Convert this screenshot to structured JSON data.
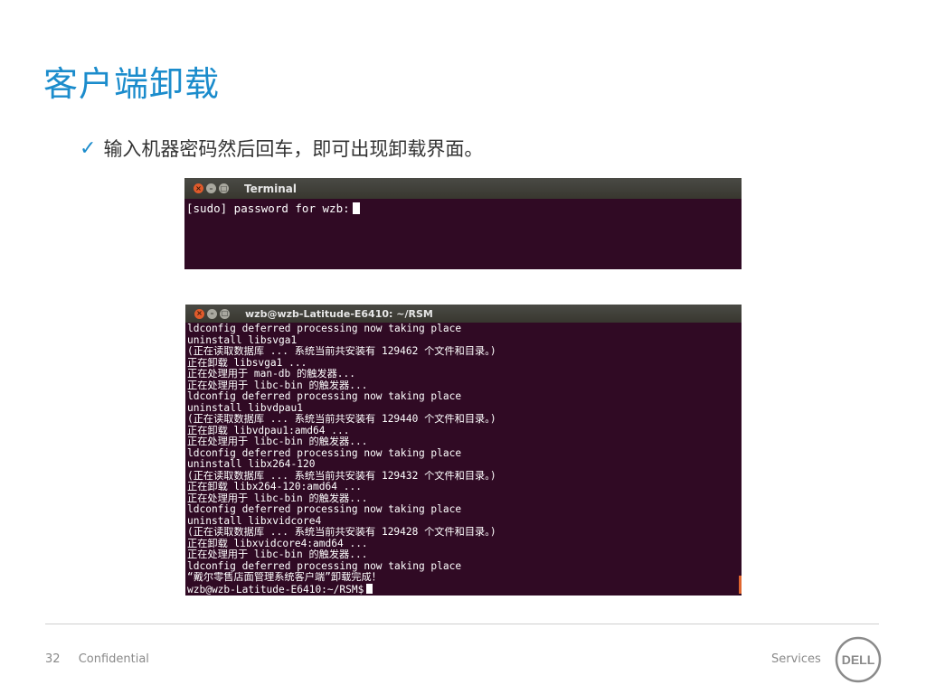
{
  "slide": {
    "title": "客户端卸载",
    "bullet": "输入机器密码然后回车，即可出现卸载界面。"
  },
  "terminal1": {
    "title": "Terminal",
    "prompt": "[sudo] password for wzb:"
  },
  "terminal2": {
    "title": "wzb@wzb-Latitude-E6410: ~/RSM",
    "lines": [
      "ldconfig deferred processing now taking place",
      "uninstall libsvga1",
      "(正在读取数据库 ... 系统当前共安装有 129462 个文件和目录。)",
      "正在卸载 libsvga1 ...",
      "正在处理用于 man-db 的触发器...",
      "正在处理用于 libc-bin 的触发器...",
      "ldconfig deferred processing now taking place",
      "uninstall libvdpau1",
      "(正在读取数据库 ... 系统当前共安装有 129440 个文件和目录。)",
      "正在卸载 libvdpau1:amd64 ...",
      "正在处理用于 libc-bin 的触发器...",
      "ldconfig deferred processing now taking place",
      "uninstall libx264-120",
      "(正在读取数据库 ... 系统当前共安装有 129432 个文件和目录。)",
      "正在卸载 libx264-120:amd64 ...",
      "正在处理用于 libc-bin 的触发器...",
      "ldconfig deferred processing now taking place",
      "uninstall libxvidcore4",
      "(正在读取数据库 ... 系统当前共安装有 129428 个文件和目录。)",
      "正在卸载 libxvidcore4:amd64 ...",
      "正在处理用于 libc-bin 的触发器...",
      "ldconfig deferred processing now taking place",
      "“戴尔零售店面管理系统客户端”卸载完成！",
      "wzb@wzb-Latitude-E6410:~/RSM$"
    ]
  },
  "footer": {
    "page_number": "32",
    "confidential": "Confidential",
    "services": "Services",
    "logo_text": "DELL"
  },
  "colors": {
    "accent": "#1b8ccc",
    "terminal_bg": "#300a24"
  }
}
